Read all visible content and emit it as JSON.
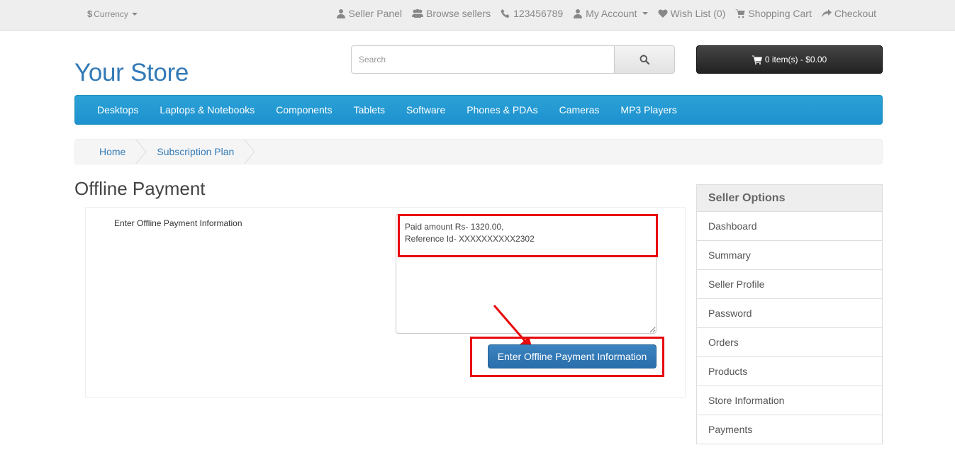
{
  "topbar": {
    "currency_symbol": "$",
    "currency_label": "Currency",
    "links": [
      {
        "icon": "user-icon",
        "label": "Seller Panel"
      },
      {
        "icon": "users-icon",
        "label": "Browse sellers"
      },
      {
        "icon": "phone-icon",
        "label": "123456789"
      },
      {
        "icon": "user-icon",
        "label": "My Account"
      },
      {
        "icon": "heart-icon",
        "label": "Wish List (0)"
      },
      {
        "icon": "cart-icon",
        "label": "Shopping Cart"
      },
      {
        "icon": "share-icon",
        "label": "Checkout"
      }
    ]
  },
  "header": {
    "logo": "Your Store",
    "search_placeholder": "Search",
    "cart_label": "0 item(s) - $0.00"
  },
  "nav": {
    "items": [
      "Desktops",
      "Laptops & Notebooks",
      "Components",
      "Tablets",
      "Software",
      "Phones & PDAs",
      "Cameras",
      "MP3 Players"
    ]
  },
  "breadcrumb": {
    "items": [
      "Home",
      "Subscription Plan"
    ]
  },
  "main": {
    "title": "Offline Payment",
    "form_label": "Enter Offline Payment Information",
    "textarea_value": "Paid amount Rs- 1320.00,\nReference Id- XXXXXXXXXX2302",
    "submit_label": "Enter Offline Payment Information"
  },
  "sidebar": {
    "title": "Seller Options",
    "items": [
      "Dashboard",
      "Summary",
      "Seller Profile",
      "Password",
      "Orders",
      "Products",
      "Store Information",
      "Payments"
    ]
  },
  "colors": {
    "brand_blue": "#337ab7",
    "nav_blue": "#229ac8",
    "highlight_red": "#e8090d"
  }
}
